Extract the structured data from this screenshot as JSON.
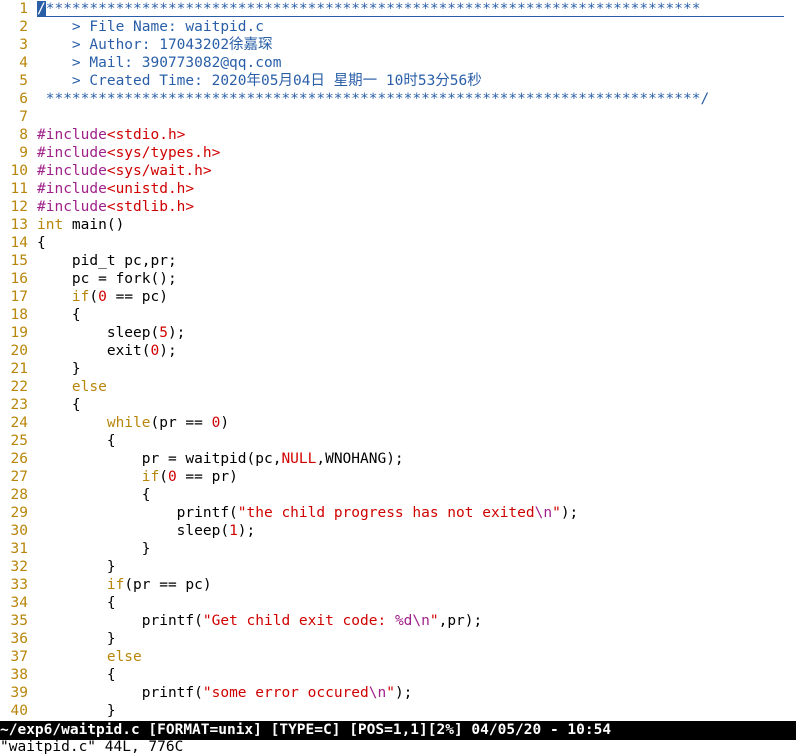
{
  "editor": {
    "lines": [
      {
        "n": "1",
        "t": [
          [
            "c",
            "/"
          ],
          [
            "comment",
            "***************************************************************************"
          ]
        ]
      },
      {
        "n": "2",
        "t": [
          [
            "comment",
            "    > File Name: waitpid.c"
          ]
        ]
      },
      {
        "n": "3",
        "t": [
          [
            "comment",
            "    > Author: 17043202徐嘉琛"
          ]
        ]
      },
      {
        "n": "4",
        "t": [
          [
            "comment",
            "    > Mail: 390773082@qq.com"
          ]
        ]
      },
      {
        "n": "5",
        "t": [
          [
            "comment",
            "    > Created Time: 2020年05月04日 星期一 10时53分56秒"
          ]
        ]
      },
      {
        "n": "6",
        "t": [
          [
            "comment",
            " ***************************************************************************/"
          ]
        ]
      },
      {
        "n": "7",
        "t": []
      },
      {
        "n": "8",
        "t": [
          [
            "pre",
            "#include"
          ],
          [
            "inc",
            "<stdio.h>"
          ]
        ]
      },
      {
        "n": "9",
        "t": [
          [
            "pre",
            "#include"
          ],
          [
            "inc",
            "<sys/types.h>"
          ]
        ]
      },
      {
        "n": "10",
        "t": [
          [
            "pre",
            "#include"
          ],
          [
            "inc",
            "<sys/wait.h>"
          ]
        ]
      },
      {
        "n": "11",
        "t": [
          [
            "pre",
            "#include"
          ],
          [
            "inc",
            "<unistd.h>"
          ]
        ]
      },
      {
        "n": "12",
        "t": [
          [
            "pre",
            "#include"
          ],
          [
            "inc",
            "<stdlib.h>"
          ]
        ]
      },
      {
        "n": "13",
        "t": [
          [
            "kw",
            "int"
          ],
          [
            "plain",
            " main()"
          ]
        ]
      },
      {
        "n": "14",
        "t": [
          [
            "plain",
            "{"
          ]
        ]
      },
      {
        "n": "15",
        "t": [
          [
            "plain",
            "    pid_t pc,pr;"
          ]
        ]
      },
      {
        "n": "16",
        "t": [
          [
            "plain",
            "    pc = fork();"
          ]
        ]
      },
      {
        "n": "17",
        "t": [
          [
            "plain",
            "    "
          ],
          [
            "kw",
            "if"
          ],
          [
            "plain",
            "("
          ],
          [
            "num",
            "0"
          ],
          [
            "plain",
            " == pc)"
          ]
        ]
      },
      {
        "n": "18",
        "t": [
          [
            "plain",
            "    {"
          ]
        ]
      },
      {
        "n": "19",
        "t": [
          [
            "plain",
            "        sleep("
          ],
          [
            "num",
            "5"
          ],
          [
            "plain",
            ");"
          ]
        ]
      },
      {
        "n": "20",
        "t": [
          [
            "plain",
            "        exit("
          ],
          [
            "num",
            "0"
          ],
          [
            "plain",
            ");"
          ]
        ]
      },
      {
        "n": "21",
        "t": [
          [
            "plain",
            "    }"
          ]
        ]
      },
      {
        "n": "22",
        "t": [
          [
            "plain",
            "    "
          ],
          [
            "kw",
            "else"
          ]
        ]
      },
      {
        "n": "23",
        "t": [
          [
            "plain",
            "    {"
          ]
        ]
      },
      {
        "n": "24",
        "t": [
          [
            "plain",
            "        "
          ],
          [
            "kw",
            "while"
          ],
          [
            "plain",
            "(pr == "
          ],
          [
            "num",
            "0"
          ],
          [
            "plain",
            ")"
          ]
        ]
      },
      {
        "n": "25",
        "t": [
          [
            "plain",
            "        {"
          ]
        ]
      },
      {
        "n": "26",
        "t": [
          [
            "plain",
            "            pr = waitpid(pc,"
          ],
          [
            "const",
            "NULL"
          ],
          [
            "plain",
            ",WNOHANG);"
          ]
        ]
      },
      {
        "n": "27",
        "t": [
          [
            "plain",
            "            "
          ],
          [
            "kw",
            "if"
          ],
          [
            "plain",
            "("
          ],
          [
            "num",
            "0"
          ],
          [
            "plain",
            " == pr)"
          ]
        ]
      },
      {
        "n": "28",
        "t": [
          [
            "plain",
            "            {"
          ]
        ]
      },
      {
        "n": "29",
        "t": [
          [
            "plain",
            "                printf("
          ],
          [
            "str",
            "\"the child progress has not exited"
          ],
          [
            "esc",
            "\\n"
          ],
          [
            "str",
            "\""
          ],
          [
            "plain",
            ");"
          ]
        ]
      },
      {
        "n": "30",
        "t": [
          [
            "plain",
            "                sleep("
          ],
          [
            "num",
            "1"
          ],
          [
            "plain",
            ");"
          ]
        ]
      },
      {
        "n": "31",
        "t": [
          [
            "plain",
            "            }"
          ]
        ]
      },
      {
        "n": "32",
        "t": [
          [
            "plain",
            "        }"
          ]
        ]
      },
      {
        "n": "33",
        "t": [
          [
            "plain",
            "        "
          ],
          [
            "kw",
            "if"
          ],
          [
            "plain",
            "(pr == pc)"
          ]
        ]
      },
      {
        "n": "34",
        "t": [
          [
            "plain",
            "        {"
          ]
        ]
      },
      {
        "n": "35",
        "t": [
          [
            "plain",
            "            printf("
          ],
          [
            "str",
            "\"Get child exit code: "
          ],
          [
            "esc",
            "%d\\n"
          ],
          [
            "str",
            "\""
          ],
          [
            "plain",
            ",pr);"
          ]
        ]
      },
      {
        "n": "36",
        "t": [
          [
            "plain",
            "        }"
          ]
        ]
      },
      {
        "n": "37",
        "t": [
          [
            "plain",
            "        "
          ],
          [
            "kw",
            "else"
          ]
        ]
      },
      {
        "n": "38",
        "t": [
          [
            "plain",
            "        {"
          ]
        ]
      },
      {
        "n": "39",
        "t": [
          [
            "plain",
            "            printf("
          ],
          [
            "str",
            "\"some error occured"
          ],
          [
            "esc",
            "\\n"
          ],
          [
            "str",
            "\""
          ],
          [
            "plain",
            ");"
          ]
        ]
      },
      {
        "n": "40",
        "t": [
          [
            "plain",
            "        }"
          ]
        ]
      }
    ]
  },
  "statusbar": {
    "text": "~/exp6/waitpid.c [FORMAT=unix] [TYPE=C] [POS=1,1][2%] 04/05/20 - 10:54"
  },
  "cmdline": {
    "text": "\"waitpid.c\" 44L, 776C"
  }
}
